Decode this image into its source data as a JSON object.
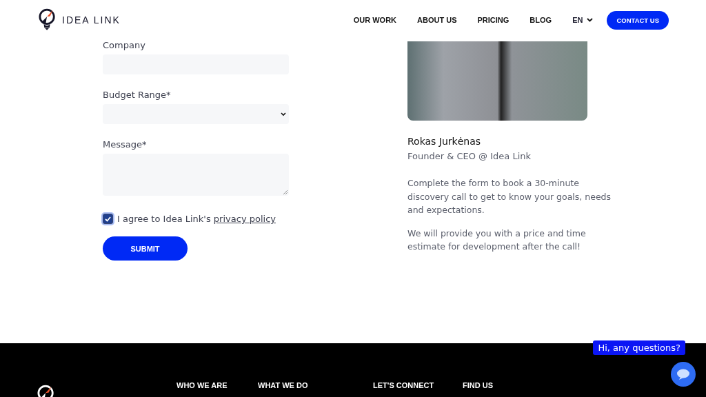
{
  "header": {
    "logo_text": "IDEA LINK",
    "nav": [
      {
        "label": "OUR WORK"
      },
      {
        "label": "ABOUT US"
      },
      {
        "label": "PRICING"
      },
      {
        "label": "BLOG"
      }
    ],
    "language": "EN",
    "cta": "CONTACT US"
  },
  "form": {
    "fields": [
      {
        "kind": "input",
        "label": "Company"
      },
      {
        "kind": "select",
        "label": "Budget Range*"
      },
      {
        "kind": "textarea",
        "label": "Message*"
      }
    ],
    "consent": {
      "checked": true,
      "text": "I agree to Idea Link's",
      "link": "privacy policy"
    },
    "submit": "SUBMIT"
  },
  "profile": {
    "name": "Rokas Jurkėnas",
    "role": "Founder & CEO @ Idea Link",
    "paragraphs": [
      "Complete the form to book a 30-minute discovery call to get to know your goals, needs and expectations.",
      "We will provide you with a price and time estimate for development after the call!"
    ]
  },
  "footer": {
    "columns": [
      "WHO WE ARE",
      "WHAT WE DO",
      "LET'S CONNECT",
      "FIND US"
    ]
  },
  "chat": {
    "greeting": "Hi, any questions?"
  }
}
